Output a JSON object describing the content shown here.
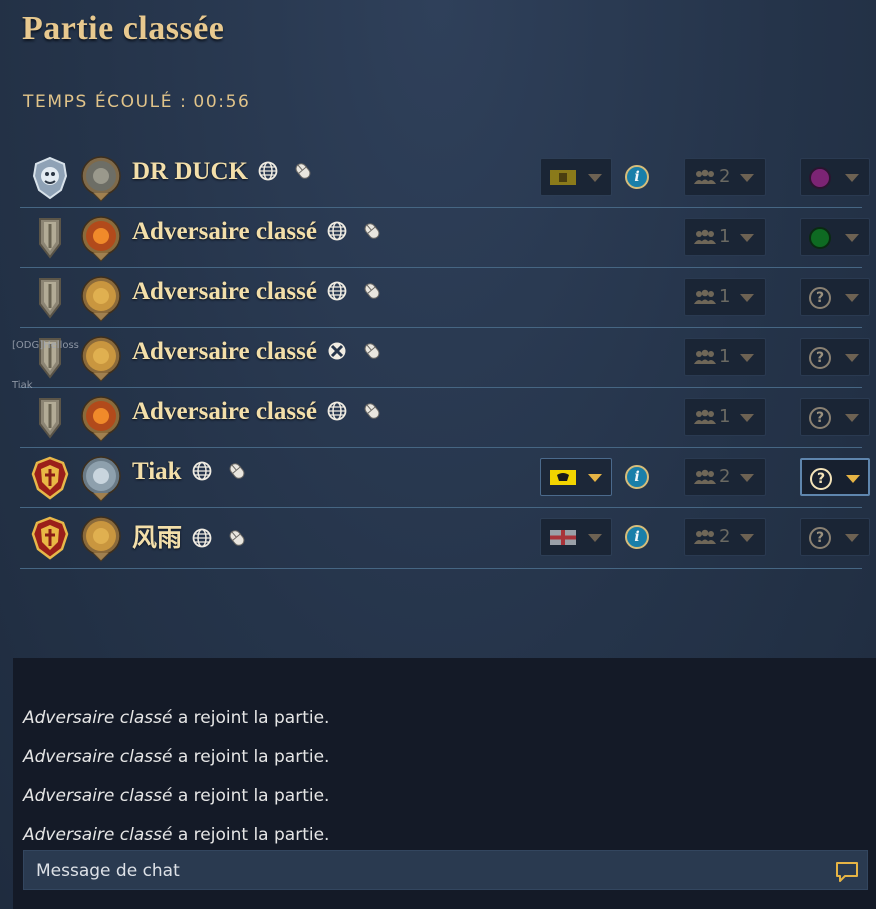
{
  "header": {
    "title": "Partie classée",
    "elapsed_label": "TEMPS ÉCOULÉ :",
    "elapsed_value": "00:56"
  },
  "players": [
    {
      "name": "DR DUCK",
      "platform": "globe-icon",
      "input": "mouse-icon",
      "civ_flag": "yellow-banner-flag",
      "has_info": true,
      "team": "2",
      "color": "purple",
      "crest": "silver-crest",
      "medal": "portrait-medal",
      "active": false
    },
    {
      "name": "Adversaire classé",
      "platform": "globe-icon",
      "input": "mouse-icon",
      "civ_flag": "",
      "has_info": false,
      "team": "1",
      "color": "green",
      "crest": "grey-shield-crest",
      "medal": "fire-medal",
      "active": false
    },
    {
      "name": "Adversaire classé",
      "platform": "globe-icon",
      "input": "mouse-icon",
      "civ_flag": "",
      "has_info": false,
      "team": "1",
      "color": "?",
      "crest": "grey-shield-crest",
      "medal": "gold-medal",
      "active": false
    },
    {
      "name": "Adversaire classé",
      "platform": "xbox-icon",
      "input": "mouse-icon",
      "civ_flag": "",
      "has_info": false,
      "team": "1",
      "color": "?",
      "crest": "grey-shield-crest",
      "medal": "gold-medal",
      "active": false
    },
    {
      "name": "Adversaire classé",
      "platform": "globe-icon",
      "input": "mouse-icon",
      "civ_flag": "",
      "has_info": false,
      "team": "1",
      "color": "?",
      "crest": "grey-shield-crest",
      "medal": "fire-medal",
      "active": false
    },
    {
      "name": "Tiak",
      "platform": "globe-icon",
      "input": "mouse-icon",
      "civ_flag": "yellow-eagle-flag",
      "has_info": true,
      "team": "2",
      "color": "?",
      "crest": "red-gold-crest",
      "medal": "silver-medal",
      "active": true
    },
    {
      "name": "风雨",
      "platform": "globe-icon",
      "input": "mouse-icon",
      "civ_flag": "english-cross-flag",
      "has_info": true,
      "team": "2",
      "color": "?",
      "crest": "red-gold-crest",
      "medal": "gold-medal",
      "active": false
    }
  ],
  "overlay_tags": [
    "[ODG]Helloss",
    "Tiak"
  ],
  "chat": {
    "messages": [
      {
        "who": "Adversaire classé",
        "text": "a rejoint la partie."
      },
      {
        "who": "Adversaire classé",
        "text": "a rejoint la partie."
      },
      {
        "who": "Adversaire classé",
        "text": "a rejoint la partie."
      },
      {
        "who": "Adversaire classé",
        "text": "a rejoint la partie."
      }
    ],
    "placeholder": "Message de chat"
  },
  "info_glyph": "i",
  "colors": {
    "title_gold": "#e8c98f",
    "name_gold": "#f3dfaa",
    "divider": "#466683",
    "purple": "#7c2474",
    "green": "#0e6a22",
    "info_blue": "#1a7fa9"
  }
}
